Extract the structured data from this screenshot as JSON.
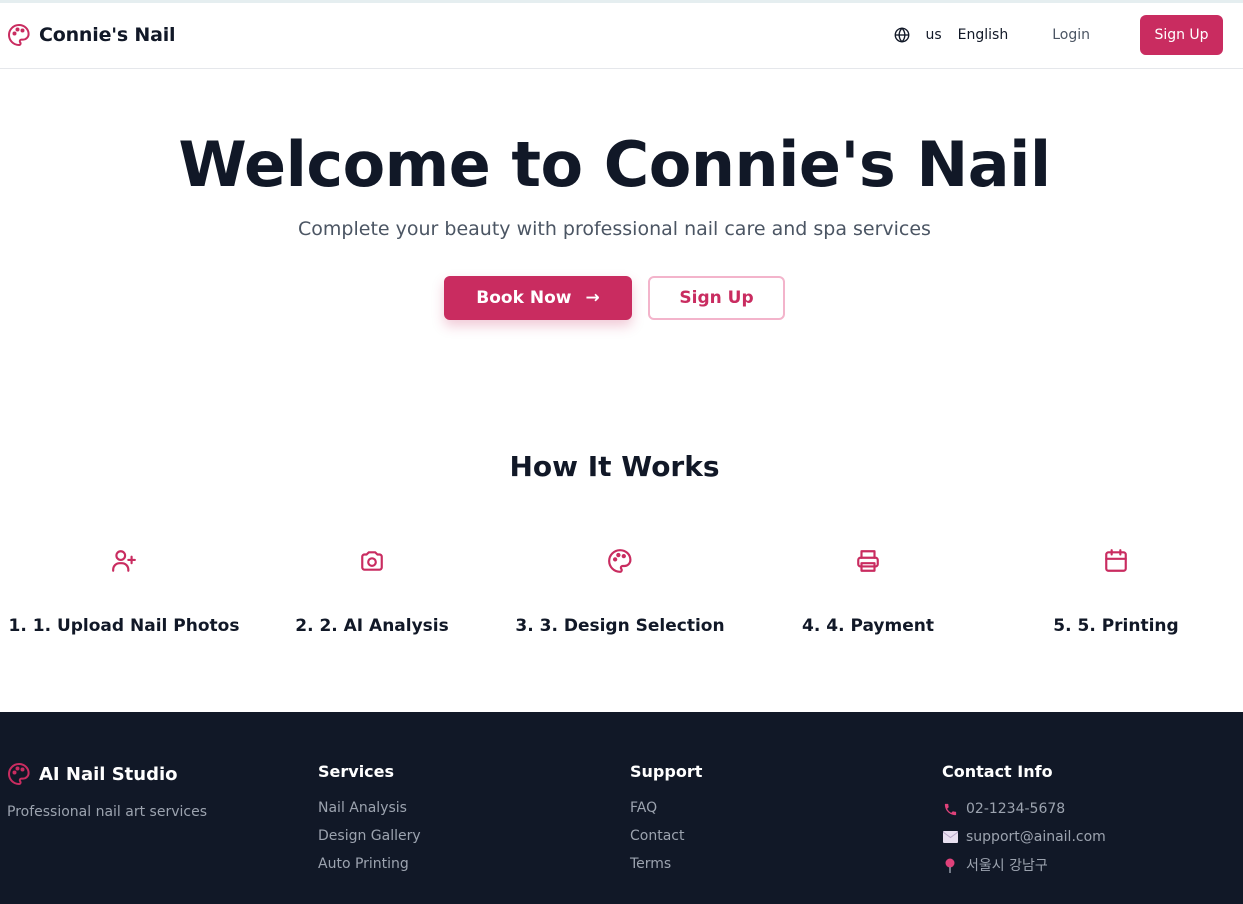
{
  "header": {
    "brand": "Connie's Nail",
    "lang_code": "us",
    "lang_label": "English",
    "login": "Login",
    "signup": "Sign Up"
  },
  "hero": {
    "title": "Welcome to Connie's Nail",
    "subtitle": "Complete your beauty with professional nail care and spa services",
    "book_label": "Book Now",
    "book_arrow": "→",
    "signup_label": "Sign Up"
  },
  "how": {
    "title": "How It Works",
    "steps": [
      {
        "icon": "user-plus-icon",
        "label": "1. 1. Upload Nail Photos"
      },
      {
        "icon": "camera-icon",
        "label": "2. 2. AI Analysis"
      },
      {
        "icon": "palette-icon",
        "label": "3. 3. Design Selection"
      },
      {
        "icon": "printer-icon",
        "label": "4. 4. Payment"
      },
      {
        "icon": "calendar-icon",
        "label": "5. 5. Printing"
      }
    ]
  },
  "footer": {
    "brand": "AI Nail Studio",
    "tagline": "Professional nail art services",
    "services": {
      "title": "Services",
      "links": [
        "Nail Analysis",
        "Design Gallery",
        "Auto Printing"
      ]
    },
    "support": {
      "title": "Support",
      "links": [
        "FAQ",
        "Contact",
        "Terms"
      ]
    },
    "contact": {
      "title": "Contact Info",
      "phone": "02-1234-5678",
      "email": "support@ainail.com",
      "address": "서울시 강남구"
    }
  },
  "colors": {
    "accent": "#c92c60",
    "accent_light": "#f3b4cb",
    "footer_bg": "#111827",
    "text_dark": "#111827",
    "text_muted": "#9ca3af"
  }
}
